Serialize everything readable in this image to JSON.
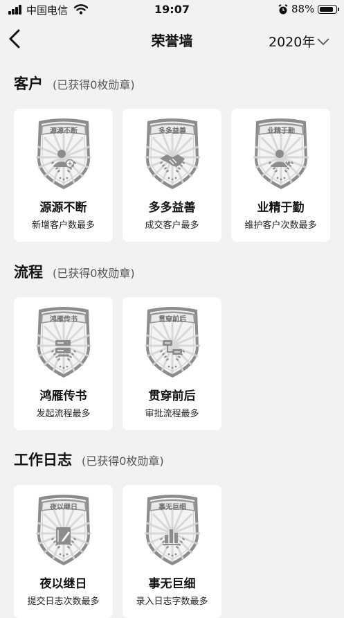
{
  "status_bar": {
    "carrier": "中国电信",
    "time": "19:07",
    "battery_percent": "88%",
    "battery_level": 0.88
  },
  "nav": {
    "title": "荣誉墙",
    "year": "2020年",
    "back_icon": "chevron-left-icon",
    "dropdown_icon": "chevron-down-icon"
  },
  "sections": [
    {
      "title": "客户",
      "count_text": "(已获得0枚勋章)",
      "badges": [
        {
          "name": "源源不断",
          "desc": "新增客户数最多",
          "icon": "add-user-icon"
        },
        {
          "name": "多多益善",
          "desc": "成交客户最多",
          "icon": "handshake-icon"
        },
        {
          "name": "业精于勤",
          "desc": "维护客户次数最多",
          "icon": "user-heart-icon"
        }
      ]
    },
    {
      "title": "流程",
      "count_text": "(已获得0枚勋章)",
      "badges": [
        {
          "name": "鸿雁传书",
          "desc": "发起流程最多",
          "icon": "flow-send-icon"
        },
        {
          "name": "贯穿前后",
          "desc": "审批流程最多",
          "icon": "flow-approve-icon"
        }
      ]
    },
    {
      "title": "工作日志",
      "count_text": "(已获得0枚勋章)",
      "badges": [
        {
          "name": "夜以继日",
          "desc": "提交日志次数最多",
          "icon": "notebook-pen-icon"
        },
        {
          "name": "事无巨细",
          "desc": "录入日志字数最多",
          "icon": "bar-chart-icon"
        }
      ]
    }
  ],
  "colors": {
    "background": "#f1f3f3",
    "card": "#ffffff",
    "badge_gray": "#8c8c8c",
    "badge_light": "#e6e6e6"
  }
}
